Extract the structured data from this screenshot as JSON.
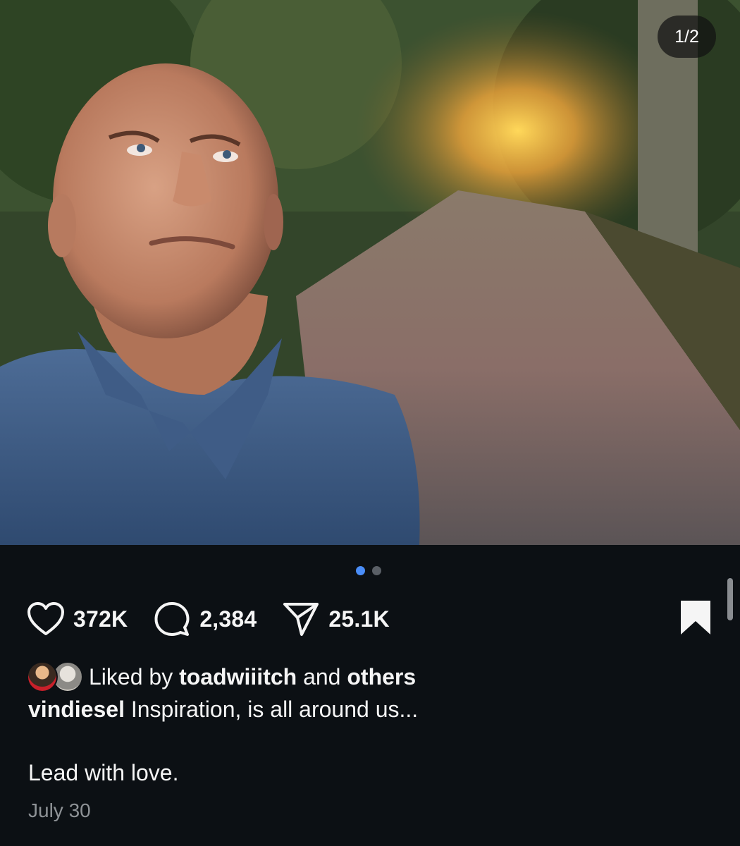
{
  "post": {
    "image_counter": "1/2",
    "carousel": {
      "total": 2,
      "active_index": 0
    },
    "likes_count": "372K",
    "comments_count": "2,384",
    "shares_count": "25.1K",
    "liked_by": {
      "prefix": "Liked by ",
      "username": "toadwiiitch",
      "conjunction": " and ",
      "others": "others"
    },
    "caption": {
      "username": "vindiesel",
      "text": " Inspiration, is all around us...",
      "line2": "Lead with love."
    },
    "date": "July 30"
  },
  "icons": {
    "like": "heart-outline-icon",
    "comment": "comment-bubble-icon",
    "share": "paper-plane-icon",
    "save": "bookmark-filled-icon"
  },
  "colors": {
    "background": "#0c1014",
    "text": "#f5f5f5",
    "muted": "#8e9296",
    "active_dot": "#4a8df8"
  }
}
